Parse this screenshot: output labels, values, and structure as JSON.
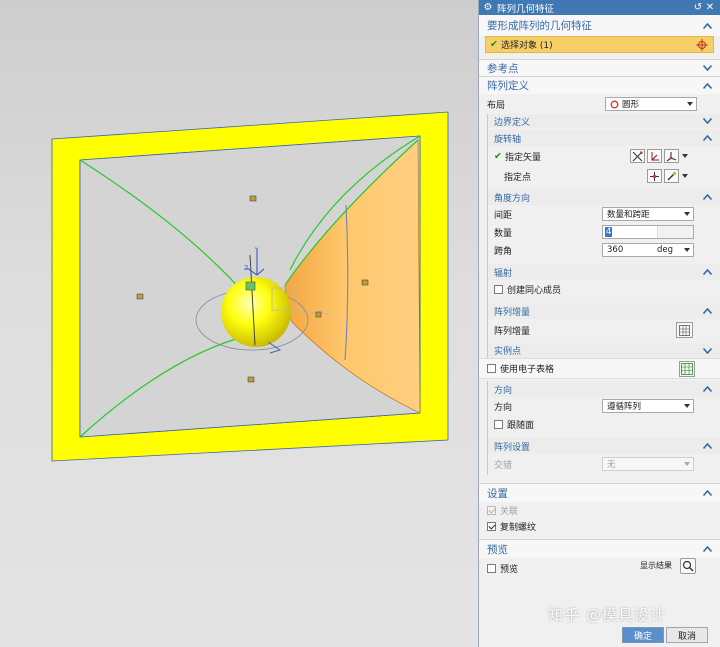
{
  "dialog": {
    "title": "阵列几何特征",
    "ok": "确定",
    "cancel": "取消"
  },
  "sections": {
    "geometry": {
      "title": "要形成阵列的几何特征",
      "select_object": "选择对象 (1)"
    },
    "reference_point": {
      "title": "参考点"
    },
    "array_definition": {
      "title": "阵列定义",
      "layout_label": "布局",
      "layout_value": "圆形",
      "boundary_title": "边界定义",
      "rotation_axis": {
        "title": "旋转轴",
        "specify_vector": "指定矢量",
        "specify_point": "指定点"
      },
      "angle_direction": {
        "title": "角度方向",
        "spacing_label": "间距",
        "spacing_value": "数量和跨距",
        "count_label": "数量",
        "count_value": "4",
        "span_label": "跨角",
        "span_value": "360",
        "span_unit": "deg"
      },
      "radiation": {
        "title": "辐射",
        "create_concentric": "创建同心成员"
      },
      "array_increment": {
        "title": "阵列增量",
        "label": "阵列增量"
      },
      "instance_point": {
        "title": "实例点"
      },
      "use_spreadsheet": "使用电子表格",
      "orientation": {
        "title": "方向",
        "label": "方向",
        "value": "遵循阵列",
        "follow_face": "跟随面"
      },
      "array_settings": {
        "title": "阵列设置",
        "stagger_label": "交错",
        "stagger_value": "无"
      }
    },
    "settings": {
      "title": "设置",
      "associative": "关联",
      "copy_threads": "复制螺纹"
    },
    "preview": {
      "title": "预览",
      "preview_label": "预览",
      "show_result": "显示结果"
    }
  },
  "watermark": "知乎 @模具设计",
  "colors": {
    "accent": "#3568a4",
    "titlebar": "#3f78b3",
    "selection": "#f7cf69",
    "frame_yellow": "#ffff00",
    "ok_button": "#5a8fcc"
  }
}
